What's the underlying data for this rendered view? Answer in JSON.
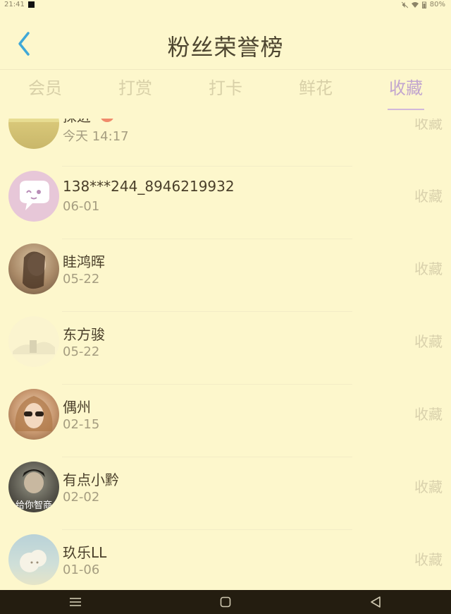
{
  "status": {
    "time": "21:41",
    "battery": "80%"
  },
  "header": {
    "title": "粉丝荣誉榜"
  },
  "tabs": [
    {
      "label": "会员",
      "active": false
    },
    {
      "label": "打赏",
      "active": false
    },
    {
      "label": "打卡",
      "active": false
    },
    {
      "label": "鲜花",
      "active": false
    },
    {
      "label": "收藏",
      "active": true
    }
  ],
  "fans": [
    {
      "name": "探进",
      "date": "今天 14:17",
      "action": "收藏"
    },
    {
      "name": "138***244_8946219932",
      "date": "06-01",
      "action": "收藏"
    },
    {
      "name": "眭鸿晖",
      "date": "05-22",
      "action": "收藏"
    },
    {
      "name": "东方骏",
      "date": "05-22",
      "action": "收藏"
    },
    {
      "name": "偶州",
      "date": "02-15",
      "action": "收藏"
    },
    {
      "name": "有点小黔",
      "date": "02-02",
      "action": "收藏"
    },
    {
      "name": "玖乐LL",
      "date": "01-06",
      "action": "收藏"
    }
  ],
  "avatar_caption": "给你智商",
  "colors": {
    "background": "#fdf7cc",
    "accent": "#c2a6cf",
    "back_icon": "#3fa8d8",
    "nav_bar": "#241d10"
  }
}
